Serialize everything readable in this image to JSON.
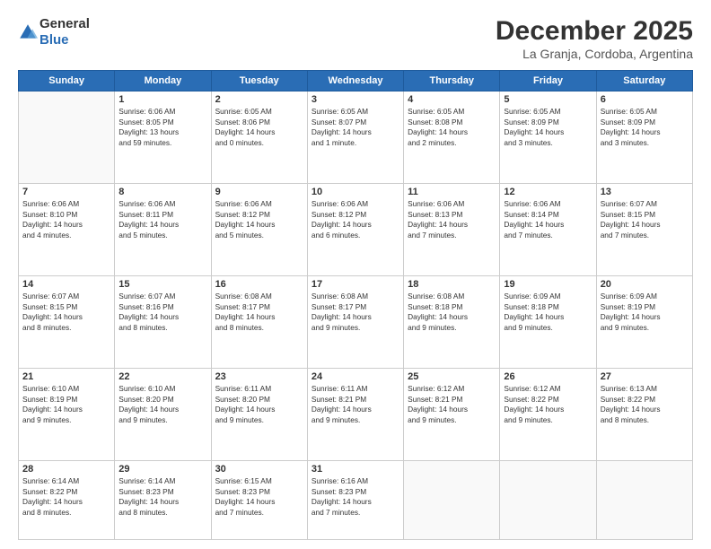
{
  "header": {
    "logo": {
      "general": "General",
      "blue": "Blue"
    },
    "title": "December 2025",
    "location": "La Granja, Cordoba, Argentina"
  },
  "calendar": {
    "days": [
      "Sunday",
      "Monday",
      "Tuesday",
      "Wednesday",
      "Thursday",
      "Friday",
      "Saturday"
    ],
    "weeks": [
      [
        {
          "day": "",
          "content": ""
        },
        {
          "day": "1",
          "content": "Sunrise: 6:06 AM\nSunset: 8:05 PM\nDaylight: 13 hours\nand 59 minutes."
        },
        {
          "day": "2",
          "content": "Sunrise: 6:05 AM\nSunset: 8:06 PM\nDaylight: 14 hours\nand 0 minutes."
        },
        {
          "day": "3",
          "content": "Sunrise: 6:05 AM\nSunset: 8:07 PM\nDaylight: 14 hours\nand 1 minute."
        },
        {
          "day": "4",
          "content": "Sunrise: 6:05 AM\nSunset: 8:08 PM\nDaylight: 14 hours\nand 2 minutes."
        },
        {
          "day": "5",
          "content": "Sunrise: 6:05 AM\nSunset: 8:09 PM\nDaylight: 14 hours\nand 3 minutes."
        },
        {
          "day": "6",
          "content": "Sunrise: 6:05 AM\nSunset: 8:09 PM\nDaylight: 14 hours\nand 3 minutes."
        }
      ],
      [
        {
          "day": "7",
          "content": "Sunrise: 6:06 AM\nSunset: 8:10 PM\nDaylight: 14 hours\nand 4 minutes."
        },
        {
          "day": "8",
          "content": "Sunrise: 6:06 AM\nSunset: 8:11 PM\nDaylight: 14 hours\nand 5 minutes."
        },
        {
          "day": "9",
          "content": "Sunrise: 6:06 AM\nSunset: 8:12 PM\nDaylight: 14 hours\nand 5 minutes."
        },
        {
          "day": "10",
          "content": "Sunrise: 6:06 AM\nSunset: 8:12 PM\nDaylight: 14 hours\nand 6 minutes."
        },
        {
          "day": "11",
          "content": "Sunrise: 6:06 AM\nSunset: 8:13 PM\nDaylight: 14 hours\nand 7 minutes."
        },
        {
          "day": "12",
          "content": "Sunrise: 6:06 AM\nSunset: 8:14 PM\nDaylight: 14 hours\nand 7 minutes."
        },
        {
          "day": "13",
          "content": "Sunrise: 6:07 AM\nSunset: 8:15 PM\nDaylight: 14 hours\nand 7 minutes."
        }
      ],
      [
        {
          "day": "14",
          "content": "Sunrise: 6:07 AM\nSunset: 8:15 PM\nDaylight: 14 hours\nand 8 minutes."
        },
        {
          "day": "15",
          "content": "Sunrise: 6:07 AM\nSunset: 8:16 PM\nDaylight: 14 hours\nand 8 minutes."
        },
        {
          "day": "16",
          "content": "Sunrise: 6:08 AM\nSunset: 8:17 PM\nDaylight: 14 hours\nand 8 minutes."
        },
        {
          "day": "17",
          "content": "Sunrise: 6:08 AM\nSunset: 8:17 PM\nDaylight: 14 hours\nand 9 minutes."
        },
        {
          "day": "18",
          "content": "Sunrise: 6:08 AM\nSunset: 8:18 PM\nDaylight: 14 hours\nand 9 minutes."
        },
        {
          "day": "19",
          "content": "Sunrise: 6:09 AM\nSunset: 8:18 PM\nDaylight: 14 hours\nand 9 minutes."
        },
        {
          "day": "20",
          "content": "Sunrise: 6:09 AM\nSunset: 8:19 PM\nDaylight: 14 hours\nand 9 minutes."
        }
      ],
      [
        {
          "day": "21",
          "content": "Sunrise: 6:10 AM\nSunset: 8:19 PM\nDaylight: 14 hours\nand 9 minutes."
        },
        {
          "day": "22",
          "content": "Sunrise: 6:10 AM\nSunset: 8:20 PM\nDaylight: 14 hours\nand 9 minutes."
        },
        {
          "day": "23",
          "content": "Sunrise: 6:11 AM\nSunset: 8:20 PM\nDaylight: 14 hours\nand 9 minutes."
        },
        {
          "day": "24",
          "content": "Sunrise: 6:11 AM\nSunset: 8:21 PM\nDaylight: 14 hours\nand 9 minutes."
        },
        {
          "day": "25",
          "content": "Sunrise: 6:12 AM\nSunset: 8:21 PM\nDaylight: 14 hours\nand 9 minutes."
        },
        {
          "day": "26",
          "content": "Sunrise: 6:12 AM\nSunset: 8:22 PM\nDaylight: 14 hours\nand 9 minutes."
        },
        {
          "day": "27",
          "content": "Sunrise: 6:13 AM\nSunset: 8:22 PM\nDaylight: 14 hours\nand 8 minutes."
        }
      ],
      [
        {
          "day": "28",
          "content": "Sunrise: 6:14 AM\nSunset: 8:22 PM\nDaylight: 14 hours\nand 8 minutes."
        },
        {
          "day": "29",
          "content": "Sunrise: 6:14 AM\nSunset: 8:23 PM\nDaylight: 14 hours\nand 8 minutes."
        },
        {
          "day": "30",
          "content": "Sunrise: 6:15 AM\nSunset: 8:23 PM\nDaylight: 14 hours\nand 7 minutes."
        },
        {
          "day": "31",
          "content": "Sunrise: 6:16 AM\nSunset: 8:23 PM\nDaylight: 14 hours\nand 7 minutes."
        },
        {
          "day": "",
          "content": ""
        },
        {
          "day": "",
          "content": ""
        },
        {
          "day": "",
          "content": ""
        }
      ]
    ]
  }
}
